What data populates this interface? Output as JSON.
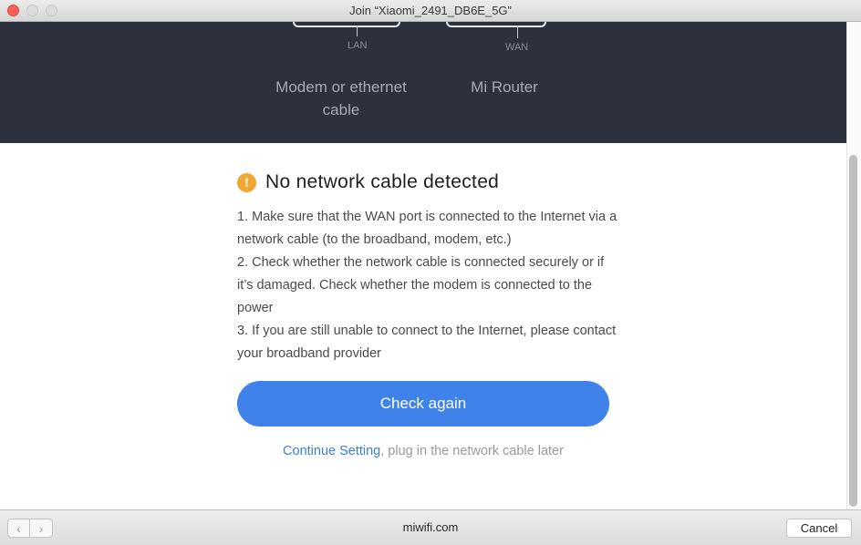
{
  "window": {
    "title": "Join “Xiaomi_2491_DB6E_5G”"
  },
  "hero": {
    "lan_label": "LAN",
    "wan_label": "WAN",
    "modem_label": "Modem or ethernet cable",
    "router_label": "Mi Router",
    "background": "#2c313d"
  },
  "alert": {
    "icon": "warning-icon",
    "icon_glyph": "!",
    "title": "No network cable detected",
    "color": "#f0a832"
  },
  "instructions": [
    "1. Make sure that the WAN port is connected to the Internet via a network cable (to the broadband, modem, etc.)",
    "2. Check whether the network cable is connected securely or if it’s damaged. Check whether the modem is connected to the power",
    "3. If you are still unable to connect to the Internet, please contact your broadband provider"
  ],
  "check_button": {
    "label": "Check again",
    "color": "#3f82ea"
  },
  "continue": {
    "link": "Continue Setting",
    "rest": ", plug in the network cable later"
  },
  "bottombar": {
    "back_glyph": "‹",
    "forward_glyph": "›",
    "url": "miwifi.com",
    "cancel_label": "Cancel"
  }
}
